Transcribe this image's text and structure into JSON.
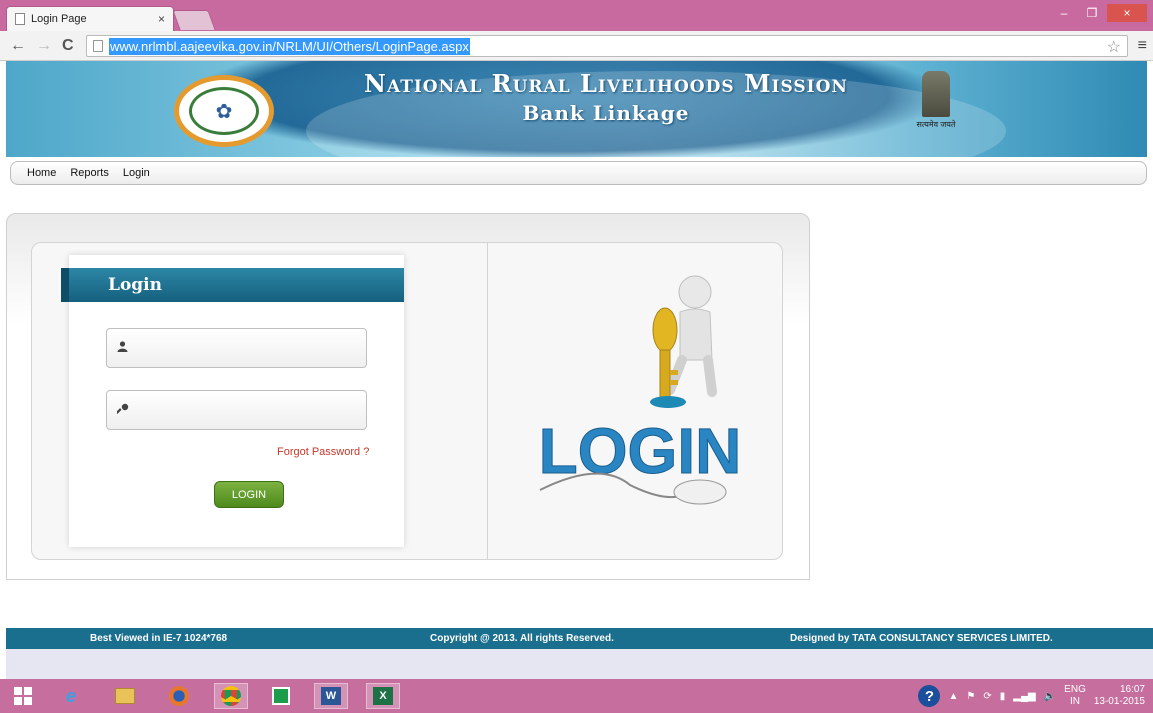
{
  "browser": {
    "tab_title": "Login Page",
    "tab_close": "×",
    "url": "www.nrlmbl.aajeevika.gov.in/NRLM/UI/Others/LoginPage.aspx",
    "back": "←",
    "forward": "→",
    "reload": "C",
    "star": "☆",
    "menu": "≡",
    "minimize": "–",
    "restore": "❐",
    "close": "×"
  },
  "banner": {
    "title": "National Rural Livelihoods Mission",
    "subtitle": "Bank Linkage",
    "emblem_motto": "सत्यमेव जयते"
  },
  "nav": {
    "items": [
      "Home",
      "Reports",
      "Login"
    ]
  },
  "login": {
    "header": "Login",
    "username_icon": "user-icon",
    "password_icon": "key-icon",
    "username_value": "",
    "password_value": "",
    "forgot": "Forgot Password ?",
    "button": "LOGIN",
    "art_text": "LOGIN"
  },
  "footer": {
    "best_viewed": "Best Viewed in IE-7 1024*768",
    "copyright": "Copyright @ 2013. All rights Reserved.",
    "designed_by": "Designed by  TATA CONSULTANCY SERVICES LIMITED."
  },
  "taskbar": {
    "lang_top": "ENG",
    "lang_bottom": "IN",
    "time": "16:07",
    "date": "13-01-2015",
    "apps": [
      "start",
      "internet-explorer",
      "file-explorer",
      "firefox",
      "chrome",
      "store",
      "word",
      "excel"
    ]
  },
  "colors": {
    "tabbar": "#c86aa0",
    "banner": "#4ea7c9",
    "login_header": "#1a6e8e",
    "login_button": "#6aa22f",
    "forgot_link": "#c0392b",
    "footer": "#1a6e8e"
  }
}
